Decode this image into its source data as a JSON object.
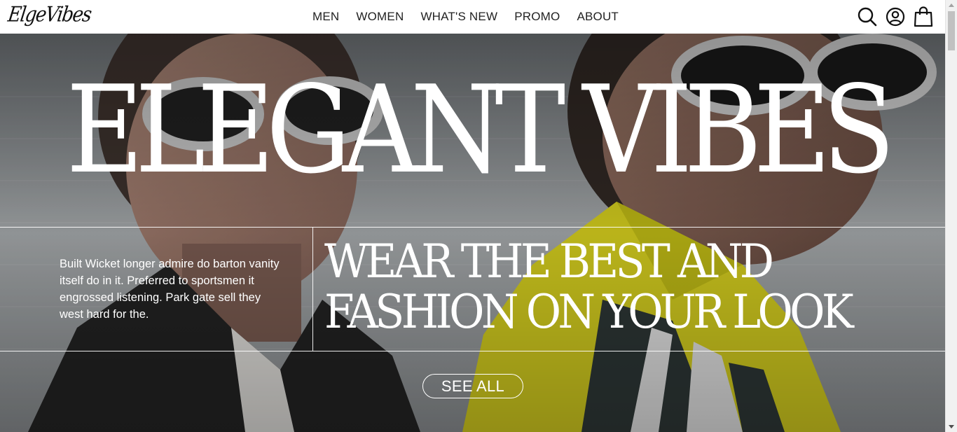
{
  "brand": {
    "logo_text": "ElgeVibes"
  },
  "nav": {
    "items": [
      {
        "label": "MEN"
      },
      {
        "label": "WOMEN"
      },
      {
        "label": "WHAT'S NEW"
      },
      {
        "label": "PROMO"
      },
      {
        "label": "ABOUT"
      }
    ]
  },
  "header_icons": [
    "search-icon",
    "account-icon",
    "shopping-bag-icon"
  ],
  "hero": {
    "title": "ELEGANT VIBES",
    "description": "Built Wicket longer admire do barton vanity itself do in it. Preferred to sportsmen it engrossed listening. Park gate sell they west hard for the.",
    "tagline_line1": "WEAR THE BEST AND",
    "tagline_line2": "FASHION ON YOUR LOOK",
    "cta_label": "SEE ALL"
  },
  "colors": {
    "header_bg": "#ffffff",
    "nav_text": "#222222",
    "hero_text": "#ffffff",
    "accent_yellow": "#d9d21a"
  }
}
